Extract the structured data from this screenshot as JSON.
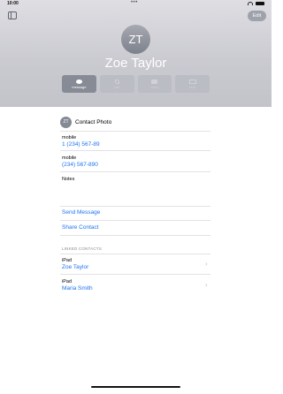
{
  "status": {
    "time": "10:00",
    "dots": "•••"
  },
  "header": {
    "edit_label": "Edit",
    "avatar_initials": "ZT",
    "name": "Zoe Taylor"
  },
  "actions": [
    {
      "label": "message",
      "icon": "message-icon",
      "enabled": true
    },
    {
      "label": "call",
      "icon": "phone-icon",
      "enabled": false
    },
    {
      "label": "video",
      "icon": "video-icon",
      "enabled": false
    },
    {
      "label": "mail",
      "icon": "mail-icon",
      "enabled": false
    }
  ],
  "contact_photo": {
    "initials": "ZT",
    "label": "Contact Photo"
  },
  "fields": [
    {
      "label": "mobile",
      "value": "1 (234) 567-89"
    },
    {
      "label": "mobile",
      "value": "(234) 567-890"
    }
  ],
  "notes_label": "Notes",
  "links": {
    "send_message": "Send Message",
    "share_contact": "Share Contact"
  },
  "linked_contacts": {
    "header": "LINKED CONTACTS",
    "items": [
      {
        "source": "iPad",
        "name": "Zoe Taylor"
      },
      {
        "source": "iPad",
        "name": "Maria  Smith"
      }
    ]
  }
}
